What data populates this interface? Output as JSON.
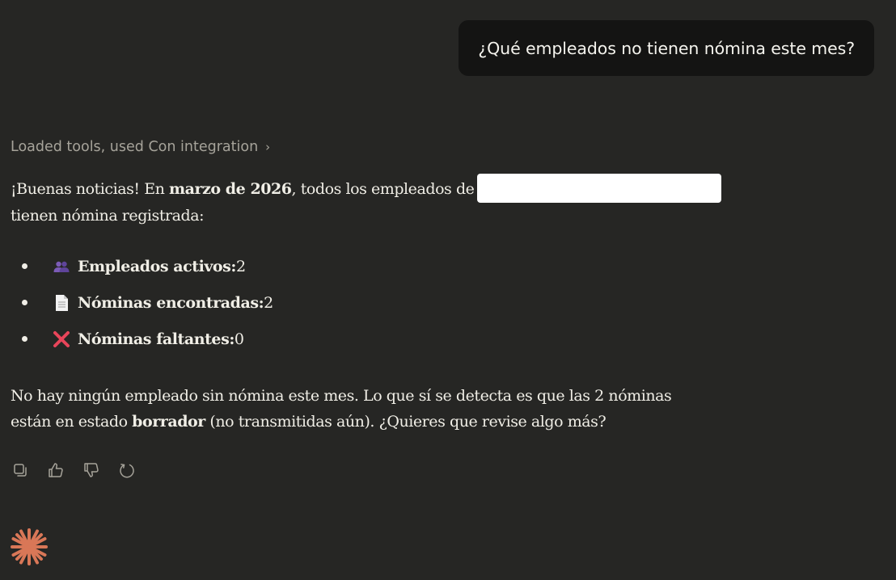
{
  "user_message": {
    "text": "¿Qué empleados no tienen nómina este mes?"
  },
  "tools_line": {
    "label": "Loaded tools, used Con integration",
    "chevron": "›"
  },
  "response": {
    "p1_start": "¡Buenas noticias! En ",
    "p1_bold": "marzo de 2026",
    "p1_mid": ", todos los empleados de",
    "p1_end": "tienen nómina registrada:",
    "bullets": [
      {
        "icon": "people-icon",
        "label": "Empleados activos:",
        "value": " 2"
      },
      {
        "icon": "document-icon",
        "label": "Nóminas encontradas:",
        "value": " 2"
      },
      {
        "icon": "cross-mark-icon",
        "label": "Nóminas faltantes:",
        "value": " 0"
      }
    ],
    "p2_start": "No hay ningún empleado sin nómina este mes. Lo que sí se detecta es que las 2 nóminas",
    "p2_mid_pre": "están en estado ",
    "p2_bold": "borrador",
    "p2_end": " (no transmitidas aún). ¿Quieres que revise algo más?"
  },
  "actions": [
    {
      "name": "copy-icon"
    },
    {
      "name": "thumbs-up-icon"
    },
    {
      "name": "thumbs-down-icon"
    },
    {
      "name": "retry-icon"
    }
  ],
  "colors": {
    "background": "#262624",
    "bubble": "#141413",
    "text": "#f0eee6",
    "muted": "#a6a39a",
    "accent": "#d97757",
    "cross": "#e8455a"
  }
}
